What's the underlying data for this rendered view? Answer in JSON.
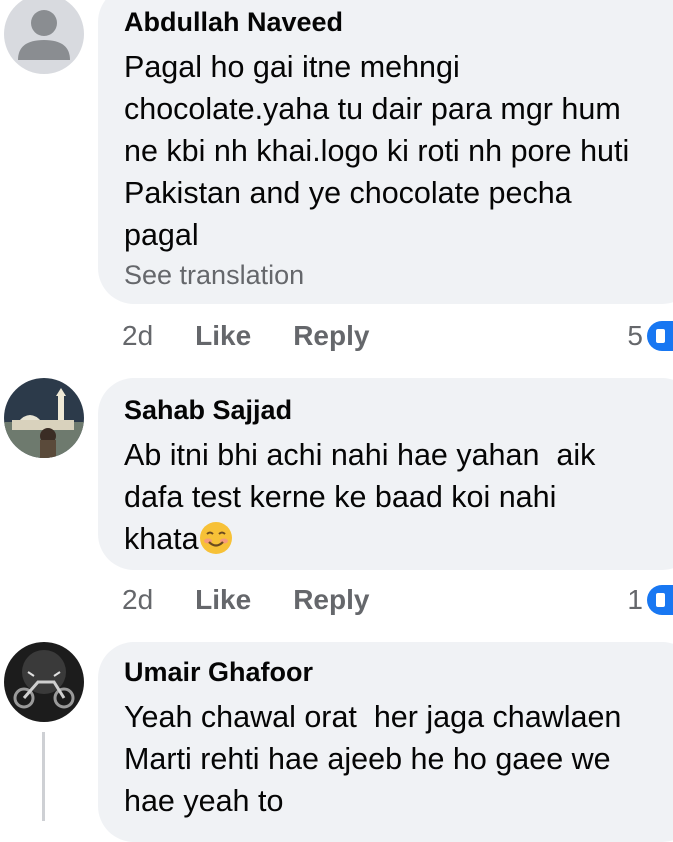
{
  "comments": [
    {
      "author": "Abdullah Naveed",
      "text": "Pagal ho gai itne mehngi\nchocolate.yaha tu dair para mgr hum\nne kbi nh khai.logo ki roti nh pore huti\nPakistan and ye chocolate pecha\npagal",
      "see_translation": "See translation",
      "time": "2d",
      "like": "Like",
      "reply": "Reply",
      "reaction_count": "5",
      "avatar_icon": "default-profile-icon"
    },
    {
      "author": "Sahab Sajjad",
      "text": "Ab itni bhi achi nahi hae yahan  aik\ndafa test kerne ke baad koi nahi\nkhata",
      "emoji": "smiling-face-emoji",
      "time": "2d",
      "like": "Like",
      "reply": "Reply",
      "reaction_count": "1",
      "avatar_icon": "mosque-photo-avatar"
    },
    {
      "author": "Umair Ghafoor",
      "text": "Yeah chawal orat  her jaga chawlaen\nMarti rehti hae ajeeb he ho gaee we\nhae yeah to",
      "avatar_icon": "motorcycle-photo-avatar"
    }
  ],
  "colors": {
    "bubble": "#f0f2f5",
    "meta_text": "#65676b",
    "reaction_blue": "#1877f2",
    "thread_line": "#ced0d4"
  }
}
